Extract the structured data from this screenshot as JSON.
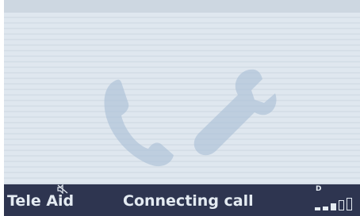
{
  "status_bar": {
    "app_name": "Tele Aid",
    "call_status": "Connecting call",
    "network_indicator": "D",
    "signal_bars_filled": 3,
    "signal_bars_total": 5
  },
  "icons": {
    "background": [
      "phone-handset-icon",
      "wrench-icon"
    ],
    "status": [
      "speaker-muted-icon",
      "signal-strength-icon"
    ]
  },
  "colors": {
    "screen_background": "#dde6ee",
    "status_bar_background": "#2e3550",
    "status_text": "#e4ebf2",
    "watermark_icons": "#a9bfd6"
  }
}
